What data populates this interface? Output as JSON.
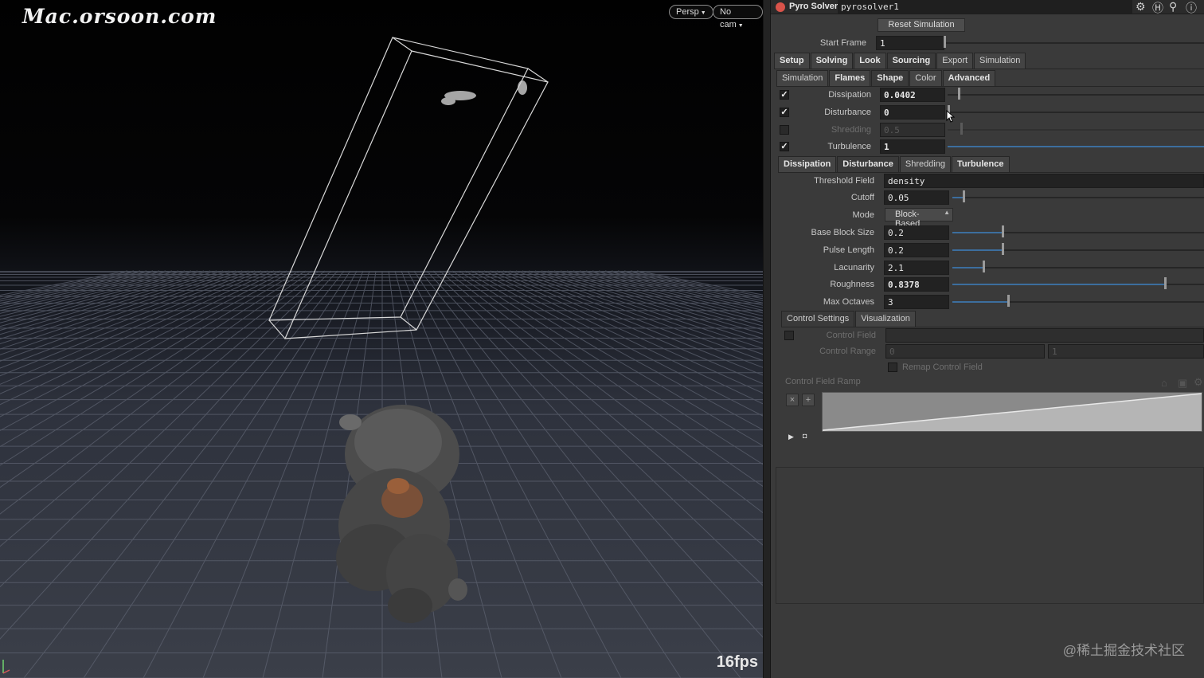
{
  "viewport": {
    "watermark": "Mac.orsoon.com",
    "persp_label": "Persp",
    "cam_label": "No cam",
    "fps": "16fps"
  },
  "header": {
    "node_type": "Pyro Solver",
    "node_name": "pyrosolver1",
    "icons": [
      "gear-icon",
      "help-card-icon",
      "search-icon",
      "info-icon"
    ]
  },
  "reset_button": "Reset Simulation",
  "start_frame": {
    "label": "Start Frame",
    "value": "1"
  },
  "main_tabs": [
    "Setup",
    "Solving",
    "Look",
    "Sourcing",
    "Export",
    "Simulation"
  ],
  "sub_tabs": [
    "Simulation",
    "Flames",
    "Shape",
    "Color",
    "Advanced"
  ],
  "shape_params": [
    {
      "label": "Dissipation",
      "value": "0.0402",
      "checked": true
    },
    {
      "label": "Disturbance",
      "value": "0",
      "checked": true
    },
    {
      "label": "Shredding",
      "value": "0.5",
      "checked": false
    },
    {
      "label": "Turbulence",
      "value": "1",
      "checked": true
    }
  ],
  "detail_tabs": [
    "Dissipation",
    "Disturbance",
    "Shredding",
    "Turbulence"
  ],
  "disturbance": {
    "threshold_field": {
      "label": "Threshold Field",
      "value": "density"
    },
    "cutoff": {
      "label": "Cutoff",
      "value": "0.05"
    },
    "mode": {
      "label": "Mode",
      "value": "Block-Based"
    },
    "base_block_size": {
      "label": "Base Block Size",
      "value": "0.2"
    },
    "pulse_length": {
      "label": "Pulse Length",
      "value": "0.2"
    },
    "lacunarity": {
      "label": "Lacunarity",
      "value": "2.1"
    },
    "roughness": {
      "label": "Roughness",
      "value": "0.8378"
    },
    "max_octaves": {
      "label": "Max Octaves",
      "value": "3"
    }
  },
  "control_tabs": [
    "Control Settings",
    "Visualization"
  ],
  "control": {
    "control_field": "Control Field",
    "control_range": "Control Range",
    "range_min": "0",
    "range_max": "1",
    "remap": "Remap Control Field",
    "ramp_label": "Control Field Ramp"
  },
  "credit": "@稀土掘金技术社区"
}
